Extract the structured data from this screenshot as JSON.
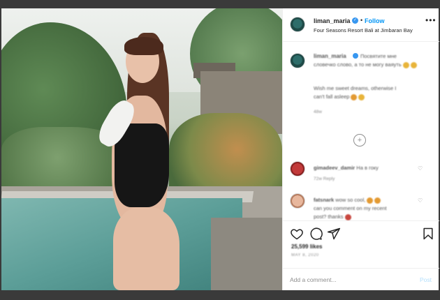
{
  "post": {
    "username": "liman_maria",
    "follow_label": "Follow",
    "separator": "•",
    "location": "Four Seasons Resort Bali at Jimbaran Bay",
    "more_label": "•••",
    "image_alt": "Photo by liman_maria at Four Seasons Resort Bali at Jimbaran Bay"
  },
  "caption": {
    "username": "liman_maria",
    "text_line1": "Посвятите мне",
    "text_line2": "словечко слово, а то не могу ваяуть",
    "text_line3": "Wish me sweet dreams, otherwise I",
    "text_line4": "can't fall asleep",
    "meta": "48w"
  },
  "load_more_label": "+",
  "comments": [
    {
      "username": "gimadeev_damir",
      "text": "На в гоку",
      "meta": "72w Reply"
    },
    {
      "username": "fatsnark",
      "text_line1": "wow so cool,",
      "text_line2": "can you comment on my recent",
      "text_line3": "post? thanks",
      "meta": ""
    }
  ],
  "actions": {
    "likes": "25,599 likes",
    "date": "MAY 8, 2020"
  },
  "add_comment": {
    "placeholder": "Add a comment...",
    "post_label": "Post"
  },
  "colors": {
    "accent": "#0095f6",
    "verified": "#3897f0",
    "post_disabled": "#b2dffc"
  }
}
